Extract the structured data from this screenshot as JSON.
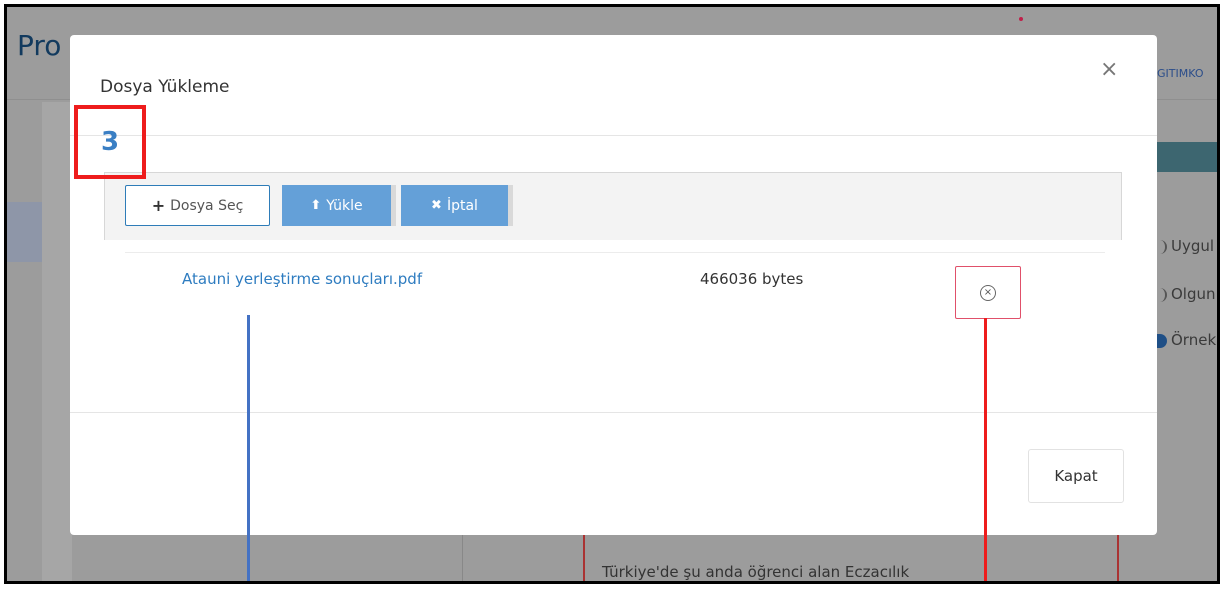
{
  "background": {
    "page_title": "Pro",
    "topright_text": "GITIMKO",
    "options": [
      "Uygul",
      "Olgun",
      "Örnek"
    ],
    "content_text": "Türkiye'de şu anda öğrenci alan Eczacılık"
  },
  "modal": {
    "title": "Dosya Yükleme",
    "close_icon": "×",
    "toolbar": {
      "choose_label": "Dosya Seç",
      "choose_icon": "+",
      "upload_label": "Yükle",
      "upload_icon": "⬆",
      "cancel_label": "İptal",
      "cancel_icon": "✖"
    },
    "file": {
      "name": "Atauni yerleştirme sonuçları.pdf",
      "size": "466036 bytes",
      "remove_icon": "×"
    },
    "footer": {
      "close_label": "Kapat"
    }
  },
  "annotation": {
    "step_number": "3",
    "box_color": "#ee1c1c",
    "blue_line_color": "#4472c4",
    "red_line_color": "#ee1c1c"
  },
  "colors": {
    "accent_blue": "#64a0d8",
    "link_blue": "#2e7cc0",
    "remove_border": "#e0506a"
  }
}
